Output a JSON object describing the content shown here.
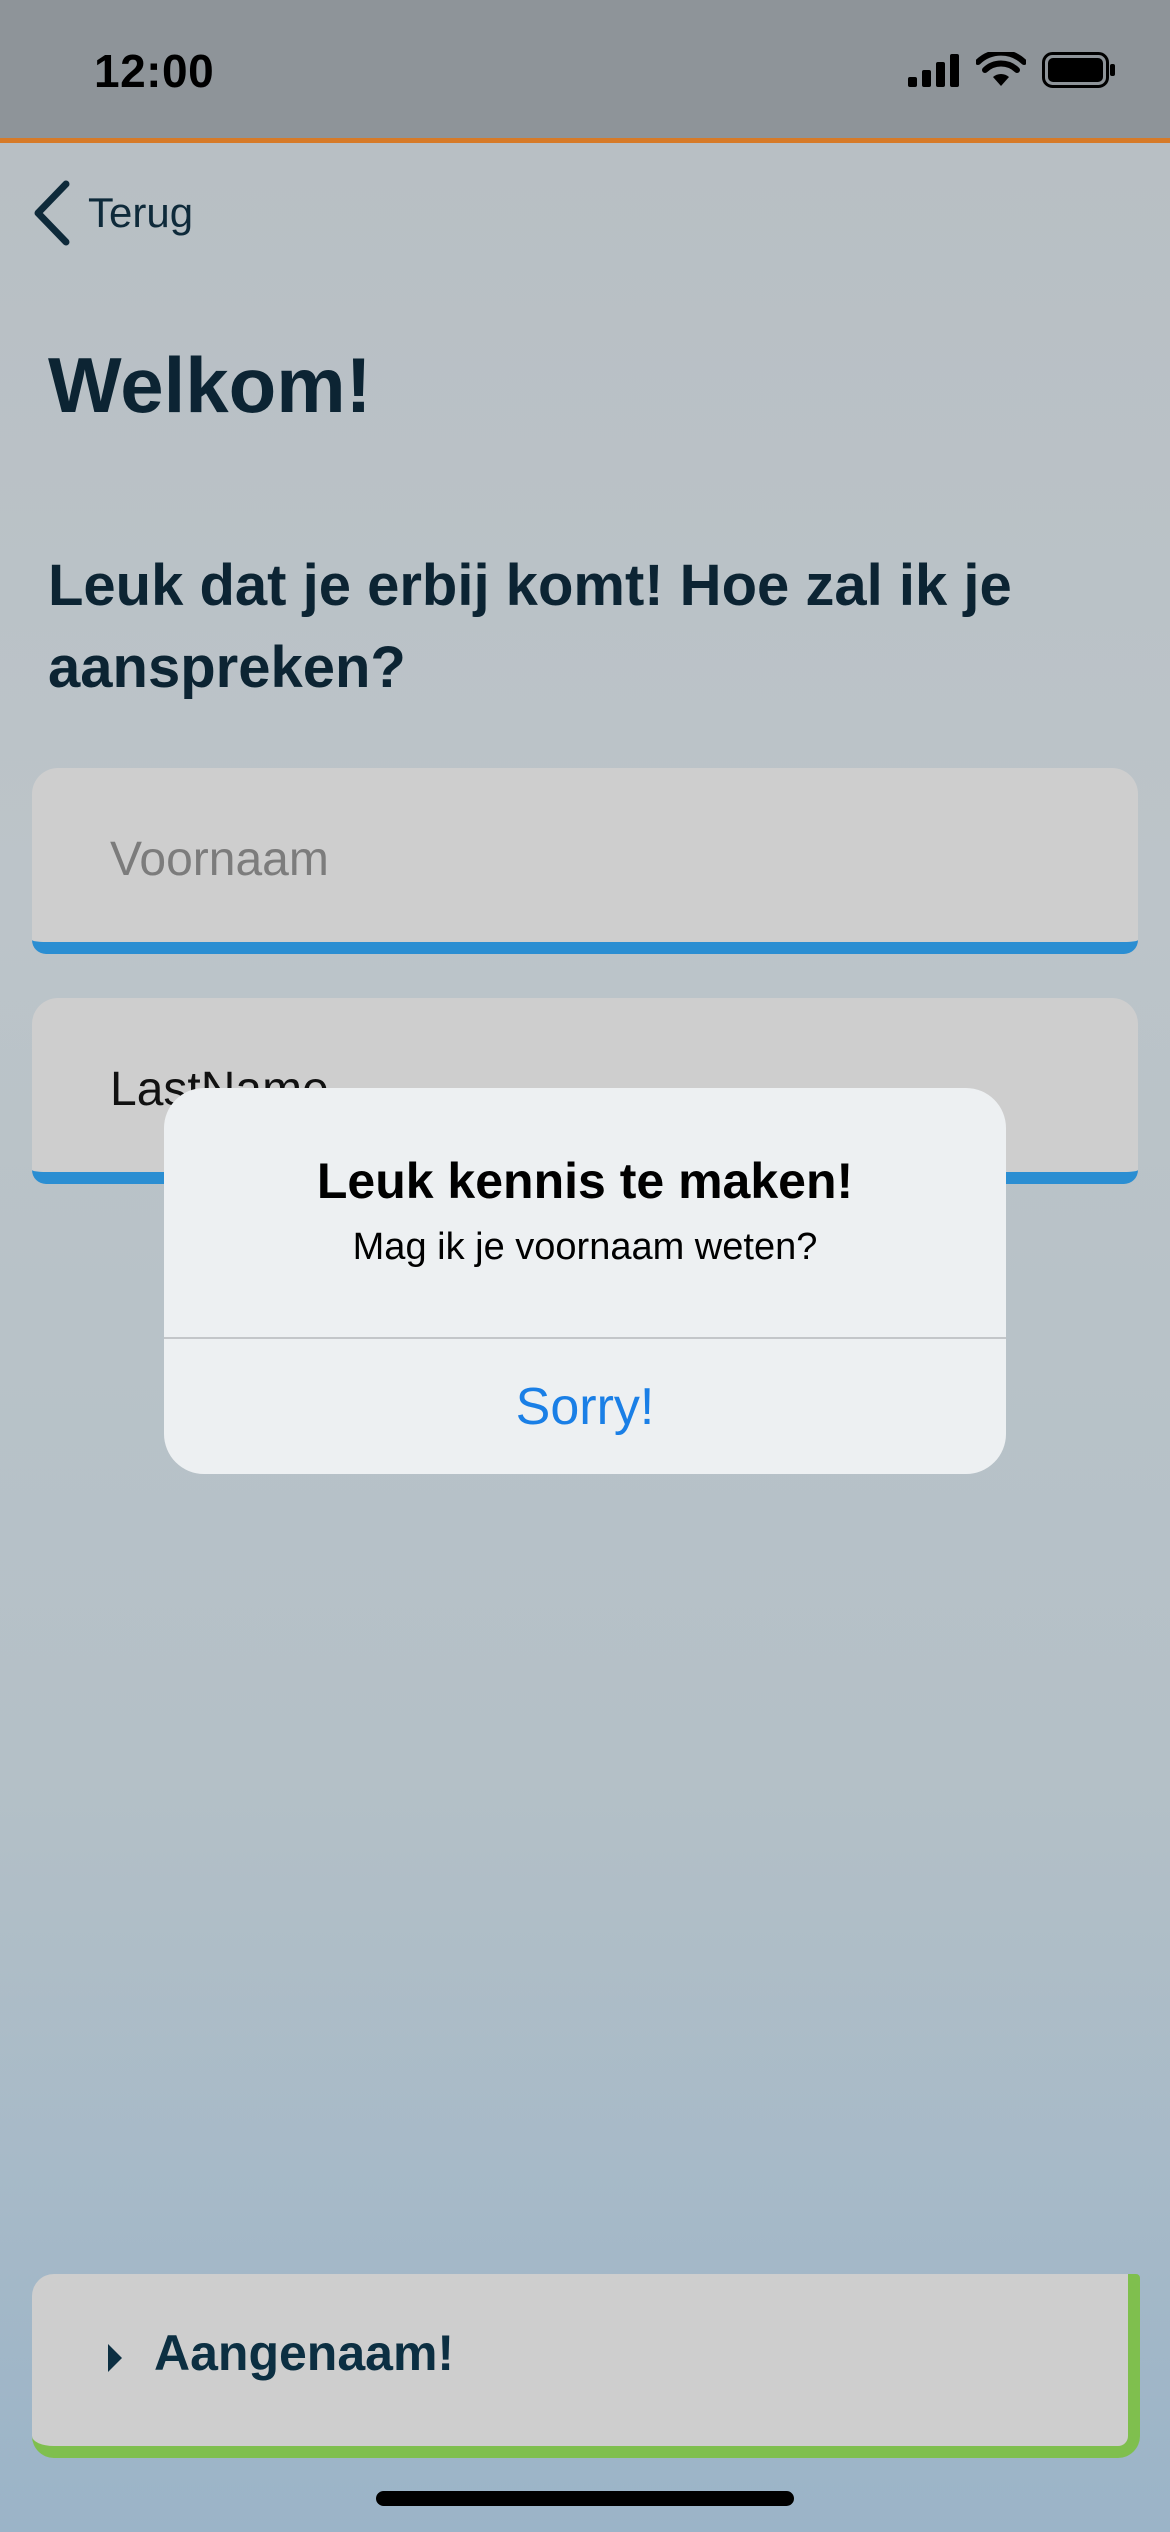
{
  "status_bar": {
    "time": "12:00",
    "accent_color": "#d67a28"
  },
  "nav": {
    "back_label": "Terug",
    "back_icon": "chevron-left-icon"
  },
  "page": {
    "title": "Welkom!",
    "subtitle": "Leuk dat je erbij komt! Hoe zal ik je aanspreken?"
  },
  "form": {
    "first_name_placeholder": "Voornaam",
    "first_name_value": "",
    "last_name_value": "LastName",
    "field_accent_color": "#2b8ed2"
  },
  "alert": {
    "title": "Leuk kennis te maken!",
    "message": "Mag ik je voornaam weten?",
    "button_label": "Sorry!",
    "button_color": "#1a7fe6"
  },
  "footer": {
    "action_label": "Aangenaam!",
    "accent_color": "#7fbf4e",
    "icon": "caret-right-icon"
  }
}
